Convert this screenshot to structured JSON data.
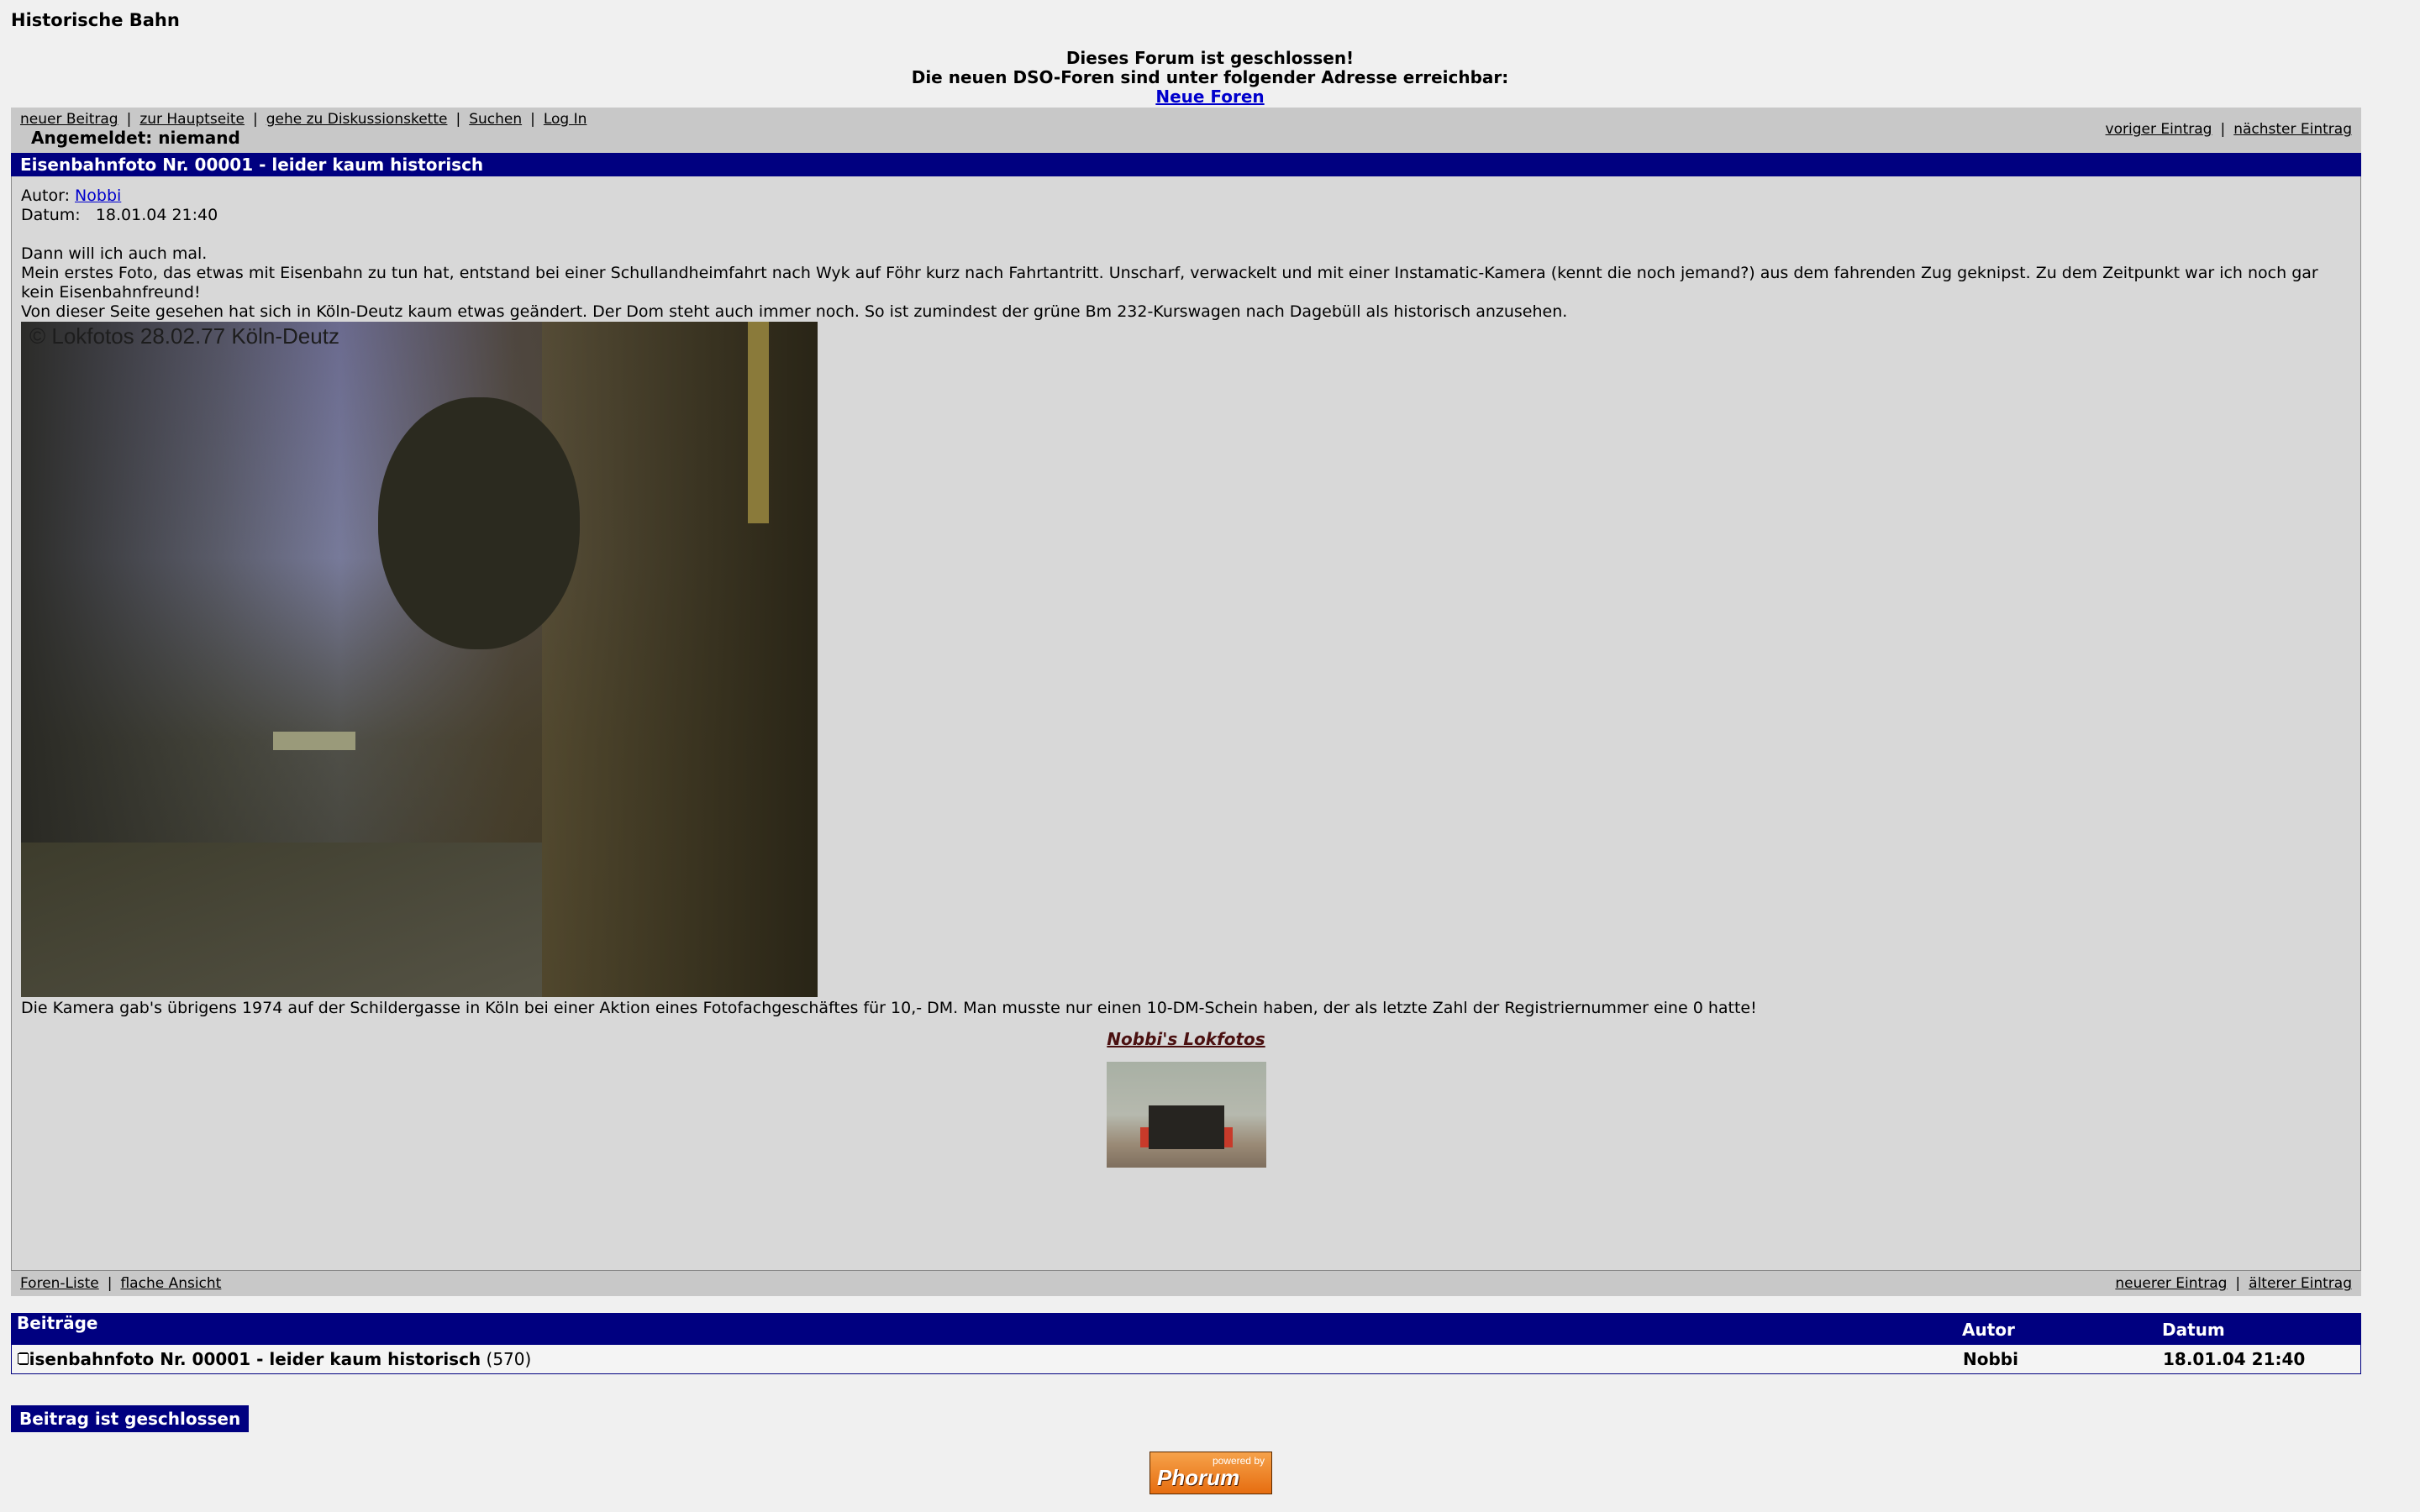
{
  "site": {
    "title": "Historische Bahn"
  },
  "notice": {
    "line1": "Dieses Forum ist geschlossen!",
    "line2": "Die neuen DSO-Foren sind unter folgender Adresse erreichbar:",
    "link": "Neue Foren"
  },
  "topnav": {
    "items": [
      "neuer Beitrag",
      "zur Hauptseite",
      "gehe zu Diskussionskette",
      "Suchen",
      "Log In"
    ],
    "logged_in": "Angemeldet: niemand",
    "prev": "voriger Eintrag",
    "next": "nächster Eintrag"
  },
  "message": {
    "title": "Eisenbahnfoto Nr. 00001 - leider kaum historisch",
    "author_label": "Autor:",
    "author": "Nobbi",
    "date_label": "Datum:",
    "date": "18.01.04 21:40",
    "p1": "Dann will ich auch mal.",
    "p2": "Mein erstes Foto, das etwas mit Eisenbahn zu tun hat, entstand bei einer Schullandheimfahrt nach Wyk auf Föhr kurz nach Fahrtantritt. Unscharf, verwackelt und mit einer Instamatic-Kamera (kennt die noch jemand?) aus dem fahrenden Zug geknipst. Zu dem Zeitpunkt war ich noch gar kein Eisenbahnfreund!",
    "p3": "Von dieser Seite gesehen hat sich in Köln-Deutz kaum etwas geändert. Der Dom steht auch immer noch. So ist zumindest der grüne Bm 232-Kurswagen nach Dagebüll als historisch anzusehen.",
    "photo_caption": "© Lokfotos 28.02.77 Köln-Deutz",
    "p4": "Die Kamera gab's übrigens 1974 auf der Schildergasse in Köln bei einer Aktion eines Fotofachgeschäftes für 10,- DM. Man musste nur einen 10-DM-Schein haben, der als letzte Zahl der Registriernummer eine 0 hatte!",
    "signature": "Nobbi's Lokfotos"
  },
  "bottomnav": {
    "left": [
      "Foren-Liste",
      "flache Ansicht"
    ],
    "right": [
      "neuerer Eintrag",
      "älterer Eintrag"
    ]
  },
  "thread": {
    "headers": {
      "posts": "Beiträge",
      "author": "Autor",
      "date": "Datum"
    },
    "row": {
      "title": "Eisenbahnfoto Nr. 00001 - leider kaum historisch",
      "count": "(570)",
      "author": "Nobbi",
      "date": "18.01.04 21:40"
    }
  },
  "closed_badge": "Beitrag ist geschlossen",
  "powered": {
    "small": "powered by",
    "big": "Phorum"
  },
  "colors": {
    "header_blue": "#000080",
    "link_blue": "#0000cc",
    "nav_gray": "#c8c8c8",
    "body_gray": "#d8d8d8"
  }
}
